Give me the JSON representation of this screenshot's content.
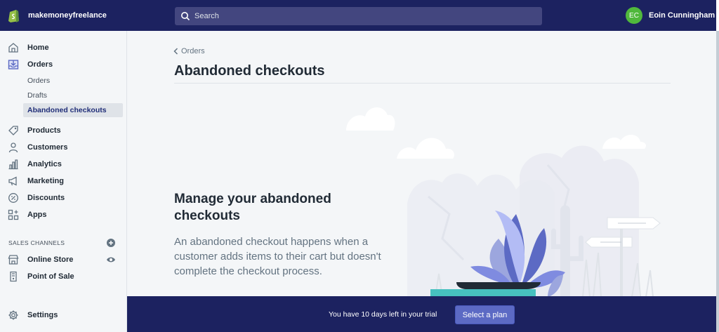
{
  "topbar": {
    "store_name": "makemoneyfreelance",
    "search_placeholder": "Search",
    "user_initials": "EC",
    "user_name": "Eoin Cunningham"
  },
  "sidebar": {
    "items": [
      {
        "label": "Home",
        "icon": "home-icon"
      },
      {
        "label": "Orders",
        "icon": "orders-icon"
      },
      {
        "label": "Products",
        "icon": "tag-icon"
      },
      {
        "label": "Customers",
        "icon": "person-icon"
      },
      {
        "label": "Analytics",
        "icon": "bar-chart-icon"
      },
      {
        "label": "Marketing",
        "icon": "megaphone-icon"
      },
      {
        "label": "Discounts",
        "icon": "discount-icon"
      },
      {
        "label": "Apps",
        "icon": "apps-icon"
      }
    ],
    "orders_sub": [
      "Orders",
      "Drafts",
      "Abandoned checkouts"
    ],
    "sales_channels_heading": "SALES CHANNELS",
    "channels": [
      {
        "label": "Online Store",
        "icon": "store-icon"
      },
      {
        "label": "Point of Sale",
        "icon": "pos-icon"
      }
    ],
    "settings_label": "Settings"
  },
  "main": {
    "breadcrumb": "Orders",
    "title": "Abandoned checkouts",
    "empty_heading": "Manage your abandoned checkouts",
    "empty_text": "An abandoned checkout happens when a customer adds items to their cart but doesn't complete the checkout process."
  },
  "trial": {
    "message": "You have 10 days left in your trial",
    "button": "Select a plan"
  },
  "colors": {
    "topbar_bg": "#1c2260",
    "accent": "#5c6ac4",
    "avatar": "#50b83c",
    "selected_nav": "#202e78"
  }
}
